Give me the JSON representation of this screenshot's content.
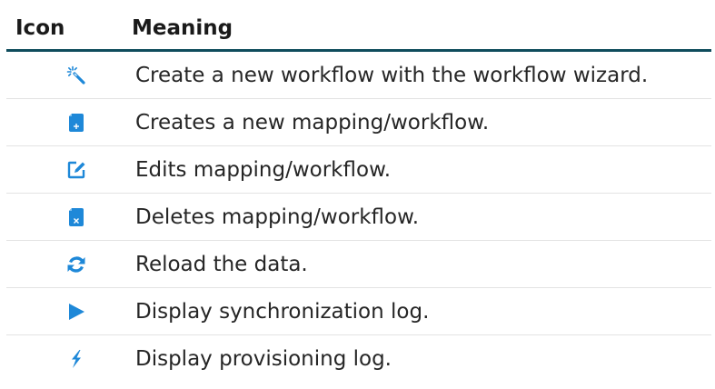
{
  "table": {
    "headers": {
      "icon": "Icon",
      "meaning": "Meaning"
    },
    "accent_color": "#1e88d8",
    "rows": [
      {
        "icon": "magic-wand-icon",
        "meaning": "Create a new workflow with the workflow wizard."
      },
      {
        "icon": "new-document-icon",
        "meaning": "Creates a new mapping/workflow."
      },
      {
        "icon": "edit-icon",
        "meaning": "Edits mapping/workflow."
      },
      {
        "icon": "delete-document-icon",
        "meaning": "Deletes mapping/workflow."
      },
      {
        "icon": "reload-icon",
        "meaning": "Reload the data."
      },
      {
        "icon": "play-icon",
        "meaning": "Display synchronization log."
      },
      {
        "icon": "lightning-icon",
        "meaning": "Display provisioning log."
      }
    ]
  }
}
